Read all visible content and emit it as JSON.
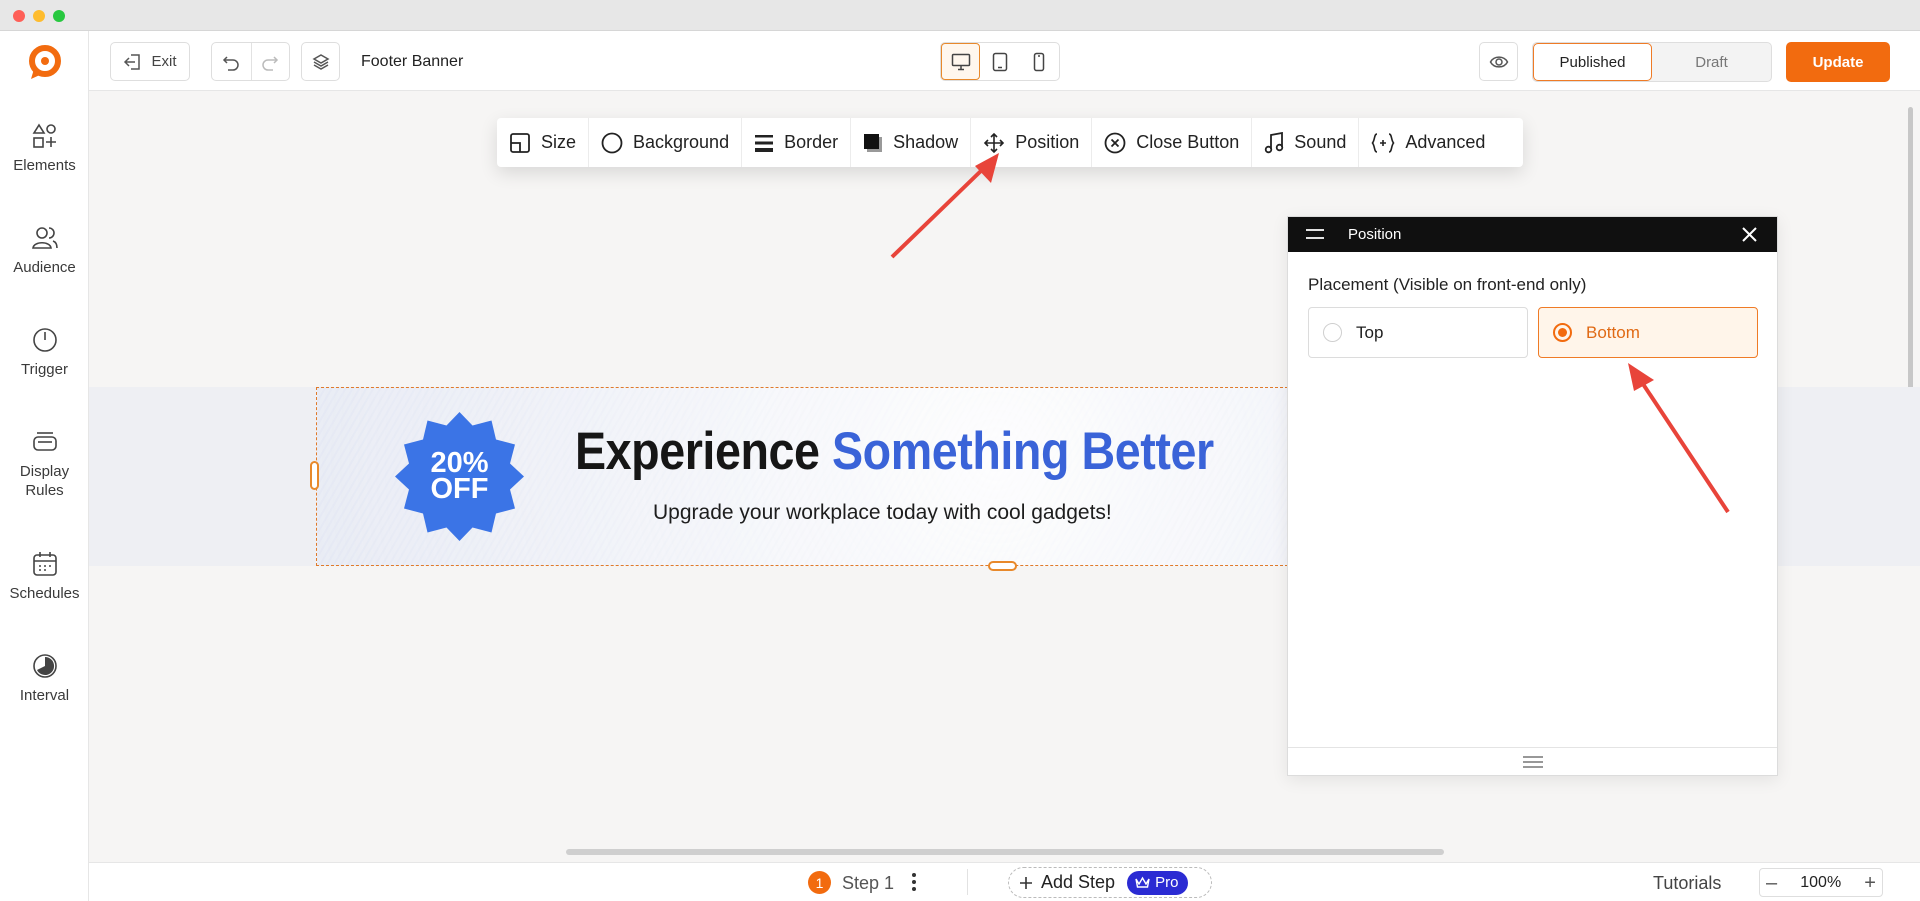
{
  "window": {
    "title": ""
  },
  "sidebar": {
    "items": [
      {
        "label": "Elements",
        "icon": "elements-icon"
      },
      {
        "label": "Audience",
        "icon": "audience-icon"
      },
      {
        "label": "Trigger",
        "icon": "power-icon"
      },
      {
        "label": "Display Rules",
        "icon": "display-rules-icon"
      },
      {
        "label": "Schedules",
        "icon": "calendar-icon"
      },
      {
        "label": "Interval",
        "icon": "interval-icon"
      }
    ]
  },
  "topbar": {
    "exit_label": "Exit",
    "doc_title": "Footer Banner",
    "devices": [
      "desktop",
      "tablet",
      "mobile"
    ],
    "active_device": "desktop",
    "status_options": [
      "Published",
      "Draft"
    ],
    "active_status": "Published",
    "update_label": "Update"
  },
  "format_toolbar": {
    "items": [
      {
        "label": "Size",
        "icon": "size-icon"
      },
      {
        "label": "Background",
        "icon": "background-icon"
      },
      {
        "label": "Border",
        "icon": "border-icon"
      },
      {
        "label": "Shadow",
        "icon": "shadow-icon"
      },
      {
        "label": "Position",
        "icon": "move-icon"
      },
      {
        "label": "Close Button",
        "icon": "close-circle-icon"
      },
      {
        "label": "Sound",
        "icon": "music-icon"
      },
      {
        "label": "Advanced",
        "icon": "code-braces-icon"
      }
    ]
  },
  "banner": {
    "badge_line1": "20%",
    "badge_line2": "OFF",
    "headline_plain": "Experience ",
    "headline_accent": "Something Better",
    "subline": "Upgrade your workplace today with cool gadgets!",
    "badge_color": "#3b74e6",
    "accent_color": "#3a63d8"
  },
  "position_panel": {
    "title": "Position",
    "placement_label": "Placement (Visible on front-end only)",
    "options": [
      "Top",
      "Bottom"
    ],
    "selected": "Bottom"
  },
  "bottombar": {
    "step_number": "1",
    "step_label": "Step 1",
    "add_step_label": "Add Step",
    "pro_label": "Pro",
    "tutorials_label": "Tutorials",
    "zoom_level": "100%"
  },
  "colors": {
    "brand_orange": "#f26b0f",
    "annotation_red": "#e8443a",
    "pro_blue": "#2b2bd3"
  }
}
